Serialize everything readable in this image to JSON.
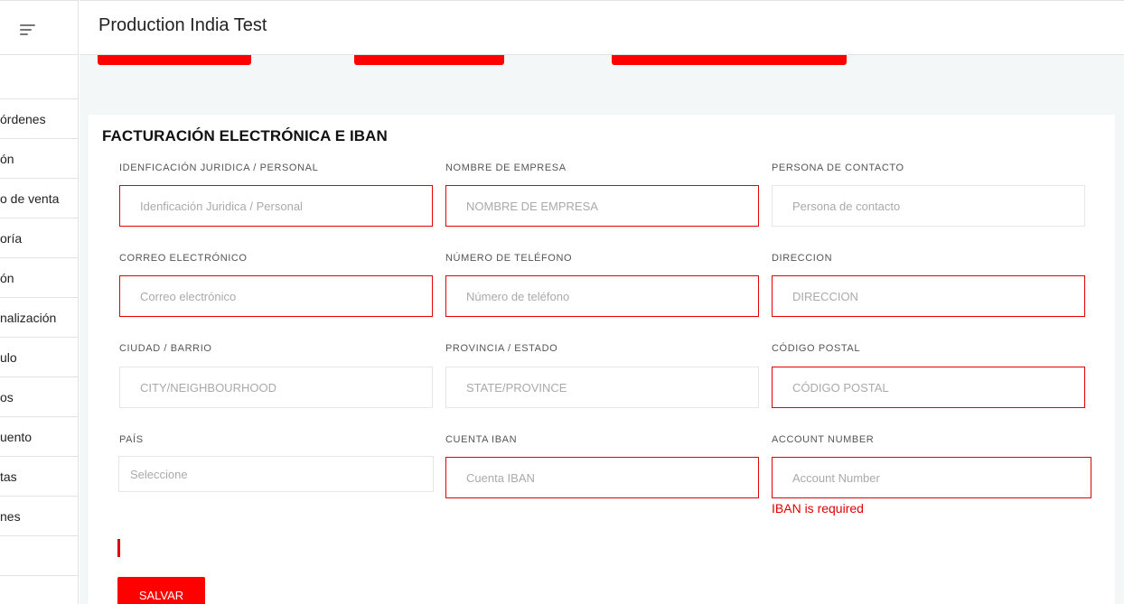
{
  "header": {
    "title": "Production India Test"
  },
  "sidebar": {
    "items": [
      {
        "label": "órdenes"
      },
      {
        "label": "ón"
      },
      {
        "label": "o de venta"
      },
      {
        "label": "oría"
      },
      {
        "label": "ón"
      },
      {
        "label": "nalización"
      },
      {
        "label": "ulo"
      },
      {
        "label": "os"
      },
      {
        "label": "uento"
      },
      {
        "label": "tas"
      },
      {
        "label": "nes"
      }
    ]
  },
  "form": {
    "title": "FACTURACIÓN ELECTRÓNICA E IBAN",
    "fields": {
      "legal_id": {
        "label": "IDENFICACIÓN JURIDICA / PERSONAL",
        "placeholder": "Idenficación Juridica / Personal",
        "value": ""
      },
      "company_name": {
        "label": "NOMBRE DE EMPRESA",
        "placeholder": "NOMBRE DE EMPRESA",
        "value": ""
      },
      "contact_person": {
        "label": "PERSONA DE CONTACTO",
        "placeholder": "Persona de contacto",
        "value": ""
      },
      "email": {
        "label": "CORREO ELECTRÓNICO",
        "placeholder": "Correo electrónico",
        "value": ""
      },
      "phone": {
        "label": "NÚMERO DE TELÉFONO",
        "placeholder": "Número de teléfono",
        "value": ""
      },
      "address": {
        "label": "DIRECCION",
        "placeholder": "DIRECCION",
        "value": ""
      },
      "city": {
        "label": "CIUDAD / BARRIO",
        "placeholder": "CITY/NEIGHBOURHOOD",
        "value": ""
      },
      "province": {
        "label": "PROVINCIA / ESTADO",
        "placeholder": "STATE/PROVINCE",
        "value": ""
      },
      "postal_code": {
        "label": "CÓDIGO POSTAL",
        "placeholder": "CÓDIGO POSTAL",
        "value": ""
      },
      "country": {
        "label": "PAÍS",
        "selected": "Seleccione"
      },
      "iban": {
        "label": "CUENTA IBAN",
        "placeholder": "Cuenta IBAN",
        "value": ""
      },
      "account_number": {
        "label": "ACCOUNT NUMBER",
        "placeholder": "Account Number",
        "value": "",
        "error": "IBAN is required"
      }
    },
    "save_label": "SALVAR"
  },
  "colors": {
    "accent": "#ff0000",
    "error": "#e00000",
    "background": "#f4f7f8"
  }
}
